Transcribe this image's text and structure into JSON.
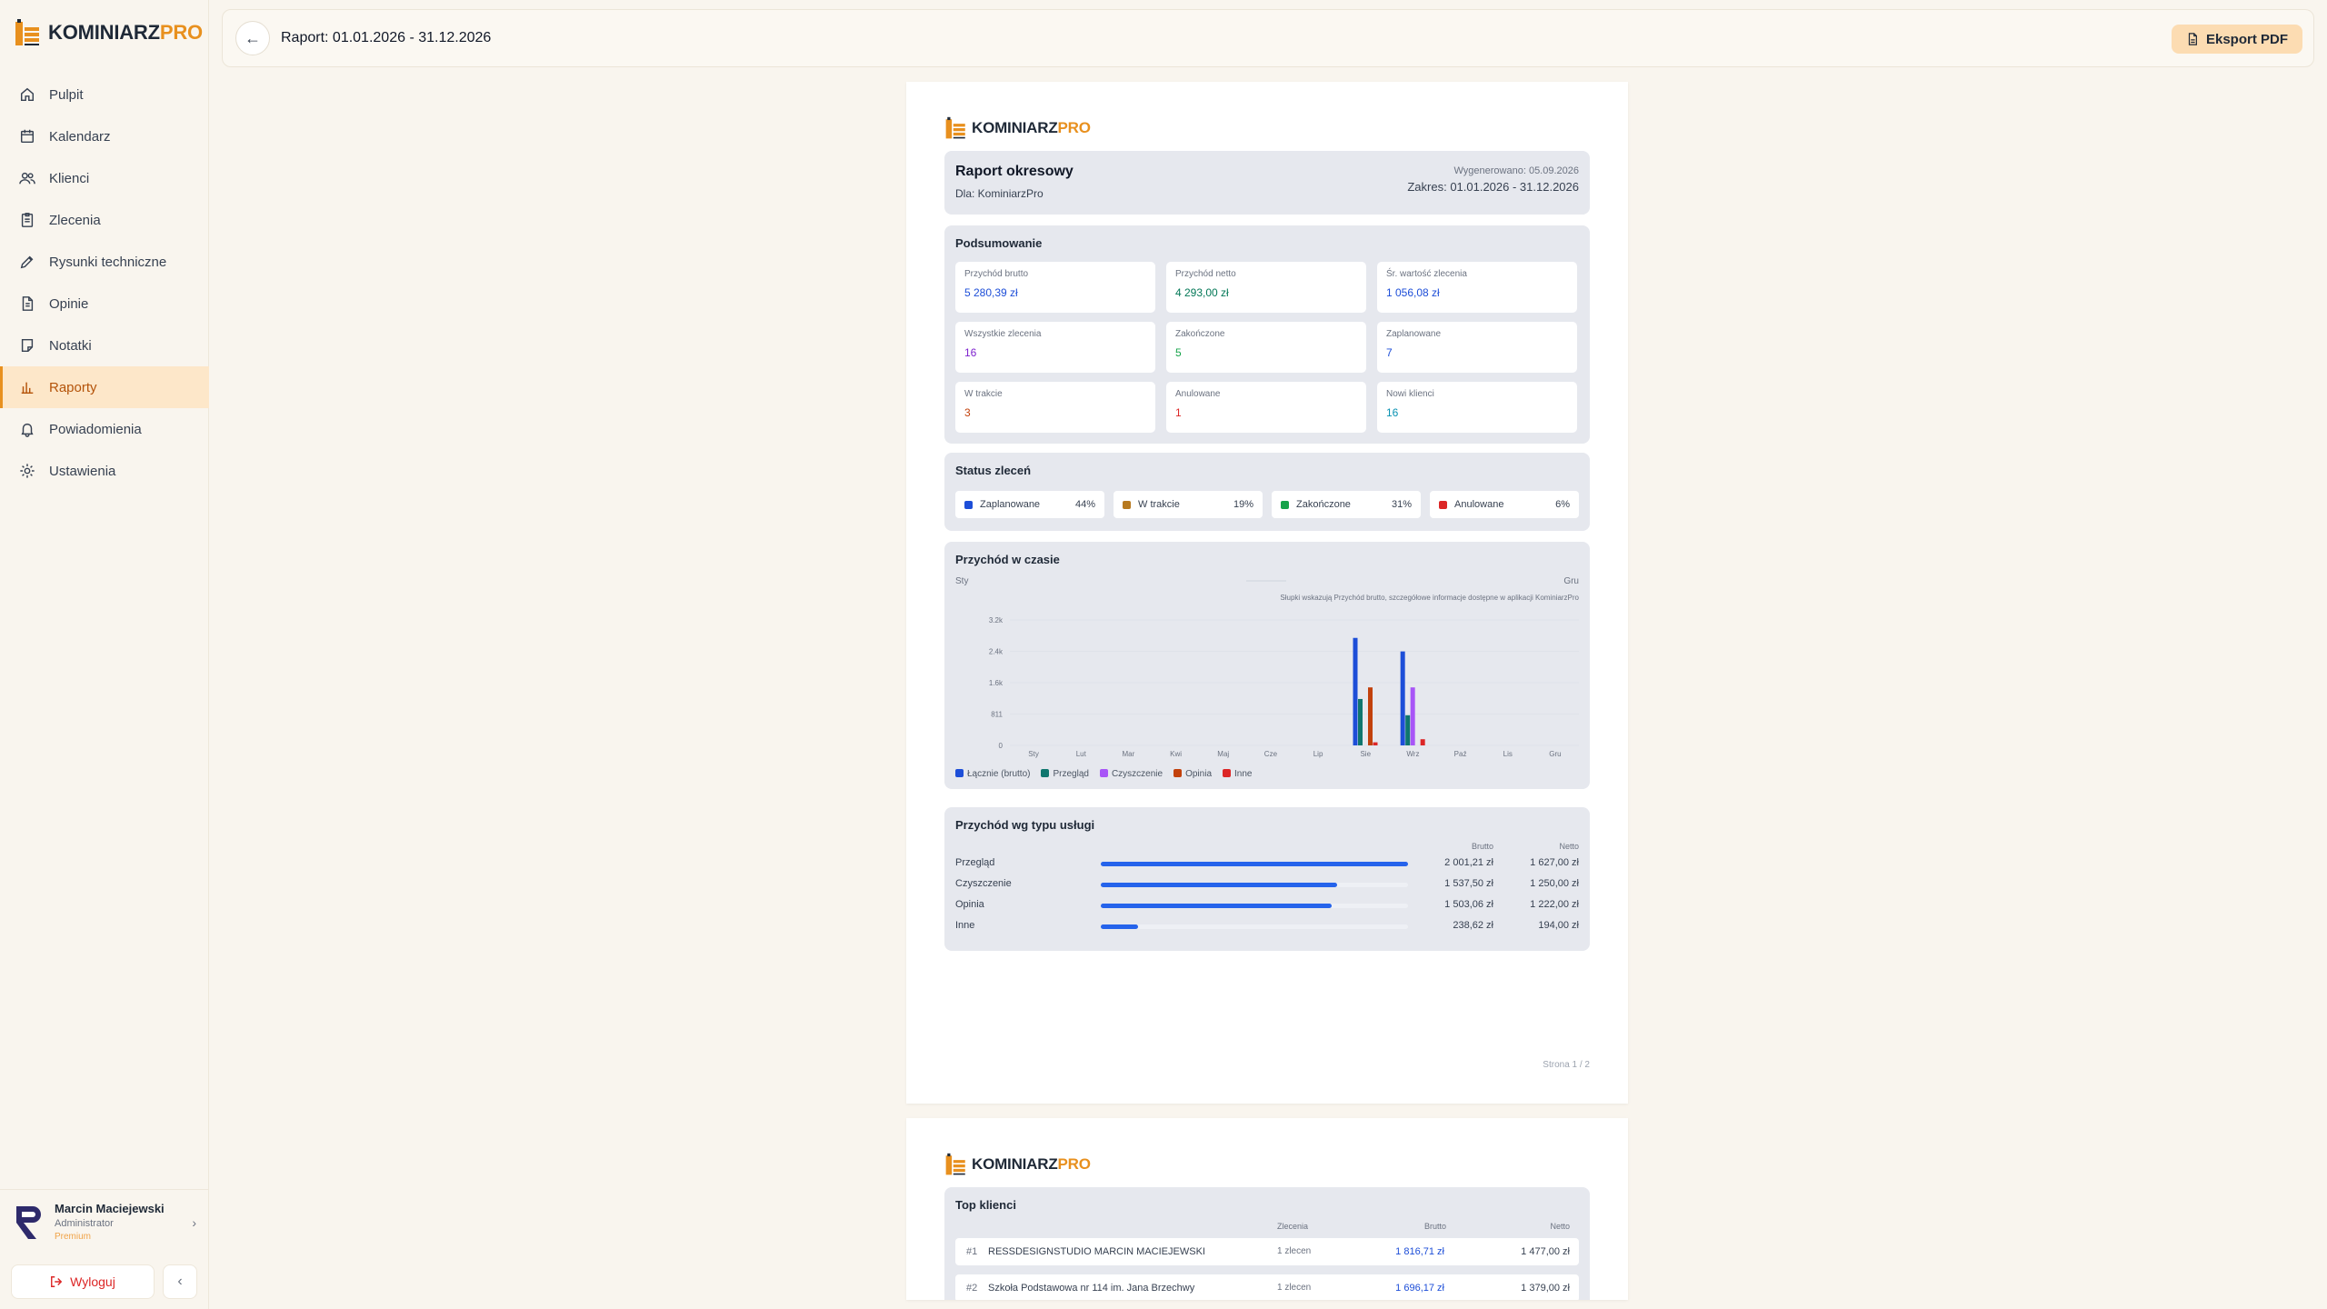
{
  "app": {
    "logo_main": "KOMINIARZ",
    "logo_accent": "PRO",
    "accent_color": "#e8901e"
  },
  "sidebar": {
    "items": [
      {
        "label": "Pulpit",
        "icon": "home-icon"
      },
      {
        "label": "Kalendarz",
        "icon": "calendar-icon"
      },
      {
        "label": "Klienci",
        "icon": "users-icon"
      },
      {
        "label": "Zlecenia",
        "icon": "clipboard-icon"
      },
      {
        "label": "Rysunki techniczne",
        "icon": "pencil-icon"
      },
      {
        "label": "Opinie",
        "icon": "document-icon"
      },
      {
        "label": "Notatki",
        "icon": "note-icon"
      },
      {
        "label": "Raporty",
        "icon": "bar-chart-icon",
        "active": true
      },
      {
        "label": "Powiadomienia",
        "icon": "bell-icon"
      },
      {
        "label": "Ustawienia",
        "icon": "gear-icon"
      }
    ],
    "user": {
      "name": "Marcin Maciejewski",
      "role": "Administrator",
      "plan": "Premium"
    },
    "logout_label": "Wyloguj"
  },
  "topbar": {
    "title": "Raport: 01.01.2026 - 31.12.2026",
    "export_label": "Eksport PDF"
  },
  "report": {
    "header": {
      "title": "Raport okresowy",
      "for": "Dla: KominiarzPro",
      "generated": "Wygenerowano: 05.09.2026",
      "range": "Zakres: 01.01.2026 - 31.12.2026"
    },
    "summary": {
      "title": "Podsumowanie",
      "stats": [
        {
          "label": "Przychód brutto",
          "value": "5 280,39 zł",
          "color": "#1d4ed8"
        },
        {
          "label": "Przychód netto",
          "value": "4 293,00 zł",
          "color": "#047857"
        },
        {
          "label": "Śr. wartość zlecenia",
          "value": "1 056,08 zł",
          "color": "#1d4ed8"
        },
        {
          "label": "Wszystkie zlecenia",
          "value": "16",
          "color": "#7e22ce"
        },
        {
          "label": "Zakończone",
          "value": "5",
          "color": "#16a34a"
        },
        {
          "label": "Zaplanowane",
          "value": "7",
          "color": "#1d4ed8"
        },
        {
          "label": "W trakcie",
          "value": "3",
          "color": "#c2410c"
        },
        {
          "label": "Anulowane",
          "value": "1",
          "color": "#dc2626"
        },
        {
          "label": "Nowi klienci",
          "value": "16",
          "color": "#0891b2"
        }
      ]
    },
    "status": {
      "title": "Status zleceń",
      "items": [
        {
          "label": "Zaplanowane",
          "pct": "44%",
          "color": "#1d4ed8"
        },
        {
          "label": "W trakcie",
          "pct": "19%",
          "color": "#b7791f"
        },
        {
          "label": "Zakończone",
          "pct": "31%",
          "color": "#16a34a"
        },
        {
          "label": "Anulowane",
          "pct": "6%",
          "color": "#dc2626"
        }
      ]
    },
    "revenue": {
      "title": "Przychód w czasie",
      "range_start": "Sty",
      "range_end": "Gru",
      "note": "Słupki wskazują Przychód brutto, szczegółowe informacje dostępne w aplikacji KominiarzPro"
    },
    "services": {
      "title": "Przychód wg typu usługi",
      "col_brutto": "Brutto",
      "col_netto": "Netto",
      "rows": [
        {
          "label": "Przegląd",
          "brutto": "2 001,21 zł",
          "netto": "1 627,00 zł",
          "share": 1.0
        },
        {
          "label": "Czyszczenie",
          "brutto": "1 537,50 zł",
          "netto": "1 250,00 zł",
          "share": 0.77
        },
        {
          "label": "Opinia",
          "brutto": "1 503,06 zł",
          "netto": "1 222,00 zł",
          "share": 0.75
        },
        {
          "label": "Inne",
          "brutto": "238,62 zł",
          "netto": "194,00 zł",
          "share": 0.12
        }
      ]
    },
    "page_label": "Strona 1 / 2",
    "top_clients": {
      "title": "Top klienci",
      "col_orders": "Zlecenia",
      "col_brutto": "Brutto",
      "col_netto": "Netto",
      "rows": [
        {
          "rank": "#1",
          "name": "RESSDESIGNSTUDIO MARCIN MACIEJEWSKI",
          "orders": "1 zlecen",
          "brutto": "1 816,71 zł",
          "netto": "1 477,00 zł"
        },
        {
          "rank": "#2",
          "name": "Szkoła Podstawowa nr 114 im. Jana Brzechwy",
          "orders": "1 zlecen",
          "brutto": "1 696,17 zł",
          "netto": "1 379,00 zł"
        }
      ]
    }
  },
  "chart_data": {
    "type": "bar",
    "categories": [
      "Sty",
      "Lut",
      "Mar",
      "Kwi",
      "Maj",
      "Cze",
      "Lip",
      "Sie",
      "Wrz",
      "Paź",
      "Lis",
      "Gru"
    ],
    "yticks": [
      "0",
      "811",
      "1.6k",
      "2.4k",
      "3.2k"
    ],
    "ylim": [
      0,
      3244
    ],
    "series": [
      {
        "name": "Łącznie (brutto)",
        "color": "#1d4ed8",
        "values": [
          0,
          0,
          0,
          0,
          0,
          0,
          0,
          2780,
          2430,
          0,
          0,
          0
        ]
      },
      {
        "name": "Przegląd",
        "color": "#0f766e",
        "values": [
          0,
          0,
          0,
          0,
          0,
          0,
          0,
          1200,
          780,
          0,
          0,
          0
        ]
      },
      {
        "name": "Czyszczenie",
        "color": "#a855f7",
        "values": [
          0,
          0,
          0,
          0,
          0,
          0,
          0,
          0,
          1500,
          0,
          0,
          0
        ]
      },
      {
        "name": "Opinia",
        "color": "#c2410c",
        "values": [
          0,
          0,
          0,
          0,
          0,
          0,
          0,
          1500,
          0,
          0,
          0,
          0
        ]
      },
      {
        "name": "Inne",
        "color": "#dc2626",
        "values": [
          0,
          0,
          0,
          0,
          0,
          0,
          0,
          80,
          160,
          0,
          0,
          0
        ]
      }
    ]
  }
}
